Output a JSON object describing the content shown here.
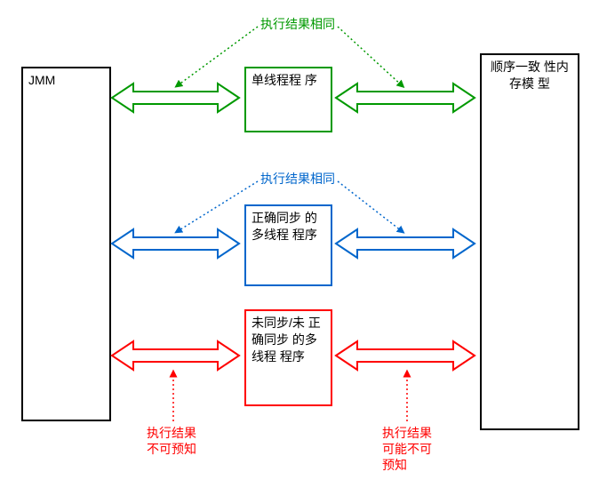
{
  "colors": {
    "green": "#009900",
    "blue": "#0066cc",
    "red": "#ff0000",
    "black": "#000000"
  },
  "leftBox": {
    "label": "JMM"
  },
  "rightBox": {
    "label": "顺序一致\n性内存模\n型"
  },
  "rows": [
    {
      "id": "single",
      "color": "green",
      "box": "单线程程\n序"
    },
    {
      "id": "sync",
      "color": "blue",
      "box": "正确同步\n的多线程\n程序"
    },
    {
      "id": "unsync",
      "color": "red",
      "box": "未同步/未\n正确同步\n的多线程\n程序"
    }
  ],
  "annotations": {
    "topGreen": "执行结果相同",
    "midBlue": "执行结果相同",
    "redLeft": "执行结果\n不可预知",
    "redRight": "执行结果\n可能不可\n预知"
  }
}
